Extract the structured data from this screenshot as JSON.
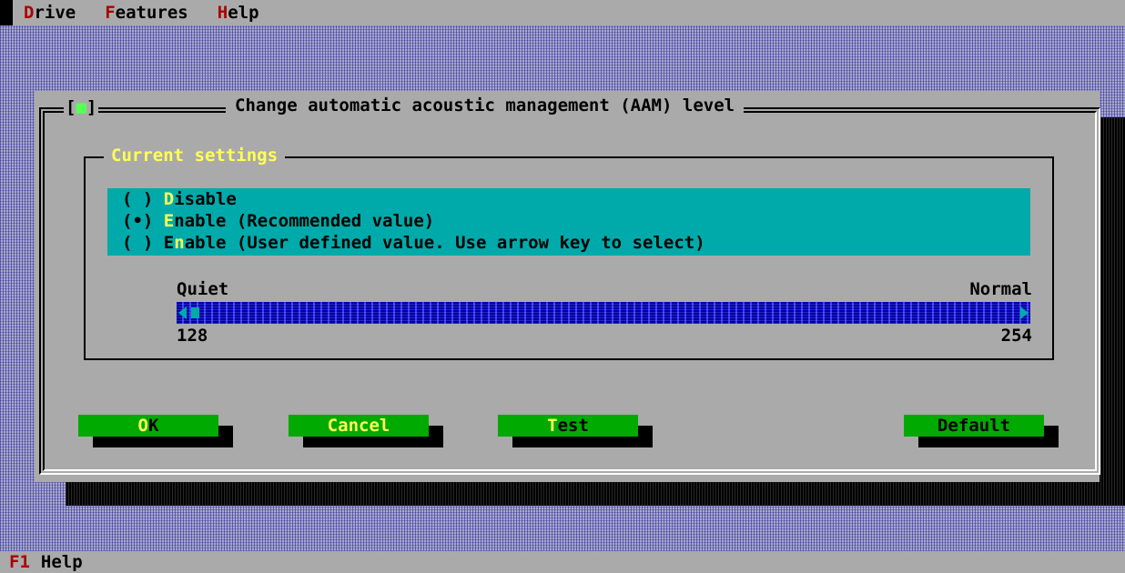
{
  "menubar": {
    "items": [
      {
        "hotkey": "D",
        "rest": "rive"
      },
      {
        "hotkey": "F",
        "rest": "eatures"
      },
      {
        "hotkey": "H",
        "rest": "elp"
      }
    ]
  },
  "dialog": {
    "close_left": "[",
    "close_dot": "■",
    "close_right": "]",
    "title": "Change automatic acoustic management (AAM) level",
    "group_label": "Current settings",
    "options": [
      {
        "mark": "( )",
        "hotkey": "D",
        "rest": "isable",
        "selected": false
      },
      {
        "mark": "(•)",
        "hotkey": "E",
        "rest": "nable (Recommended value)",
        "selected": true
      },
      {
        "mark": "( )",
        "pre": "E",
        "hotkey": "n",
        "rest": "able (User defined value. Use arrow key to select)",
        "selected": false
      }
    ],
    "scale": {
      "left_label": "Quiet",
      "right_label": "Normal",
      "min": "128",
      "max": "254"
    },
    "buttons": {
      "ok": {
        "hotkey": "O",
        "rest": "K"
      },
      "cancel": {
        "hotkey": "C",
        "rest": "ancel"
      },
      "test": {
        "hotkey": "T",
        "rest": "est"
      },
      "default": {
        "label": "Default"
      }
    }
  },
  "statusbar": {
    "key": "F1",
    "label": "Help"
  }
}
